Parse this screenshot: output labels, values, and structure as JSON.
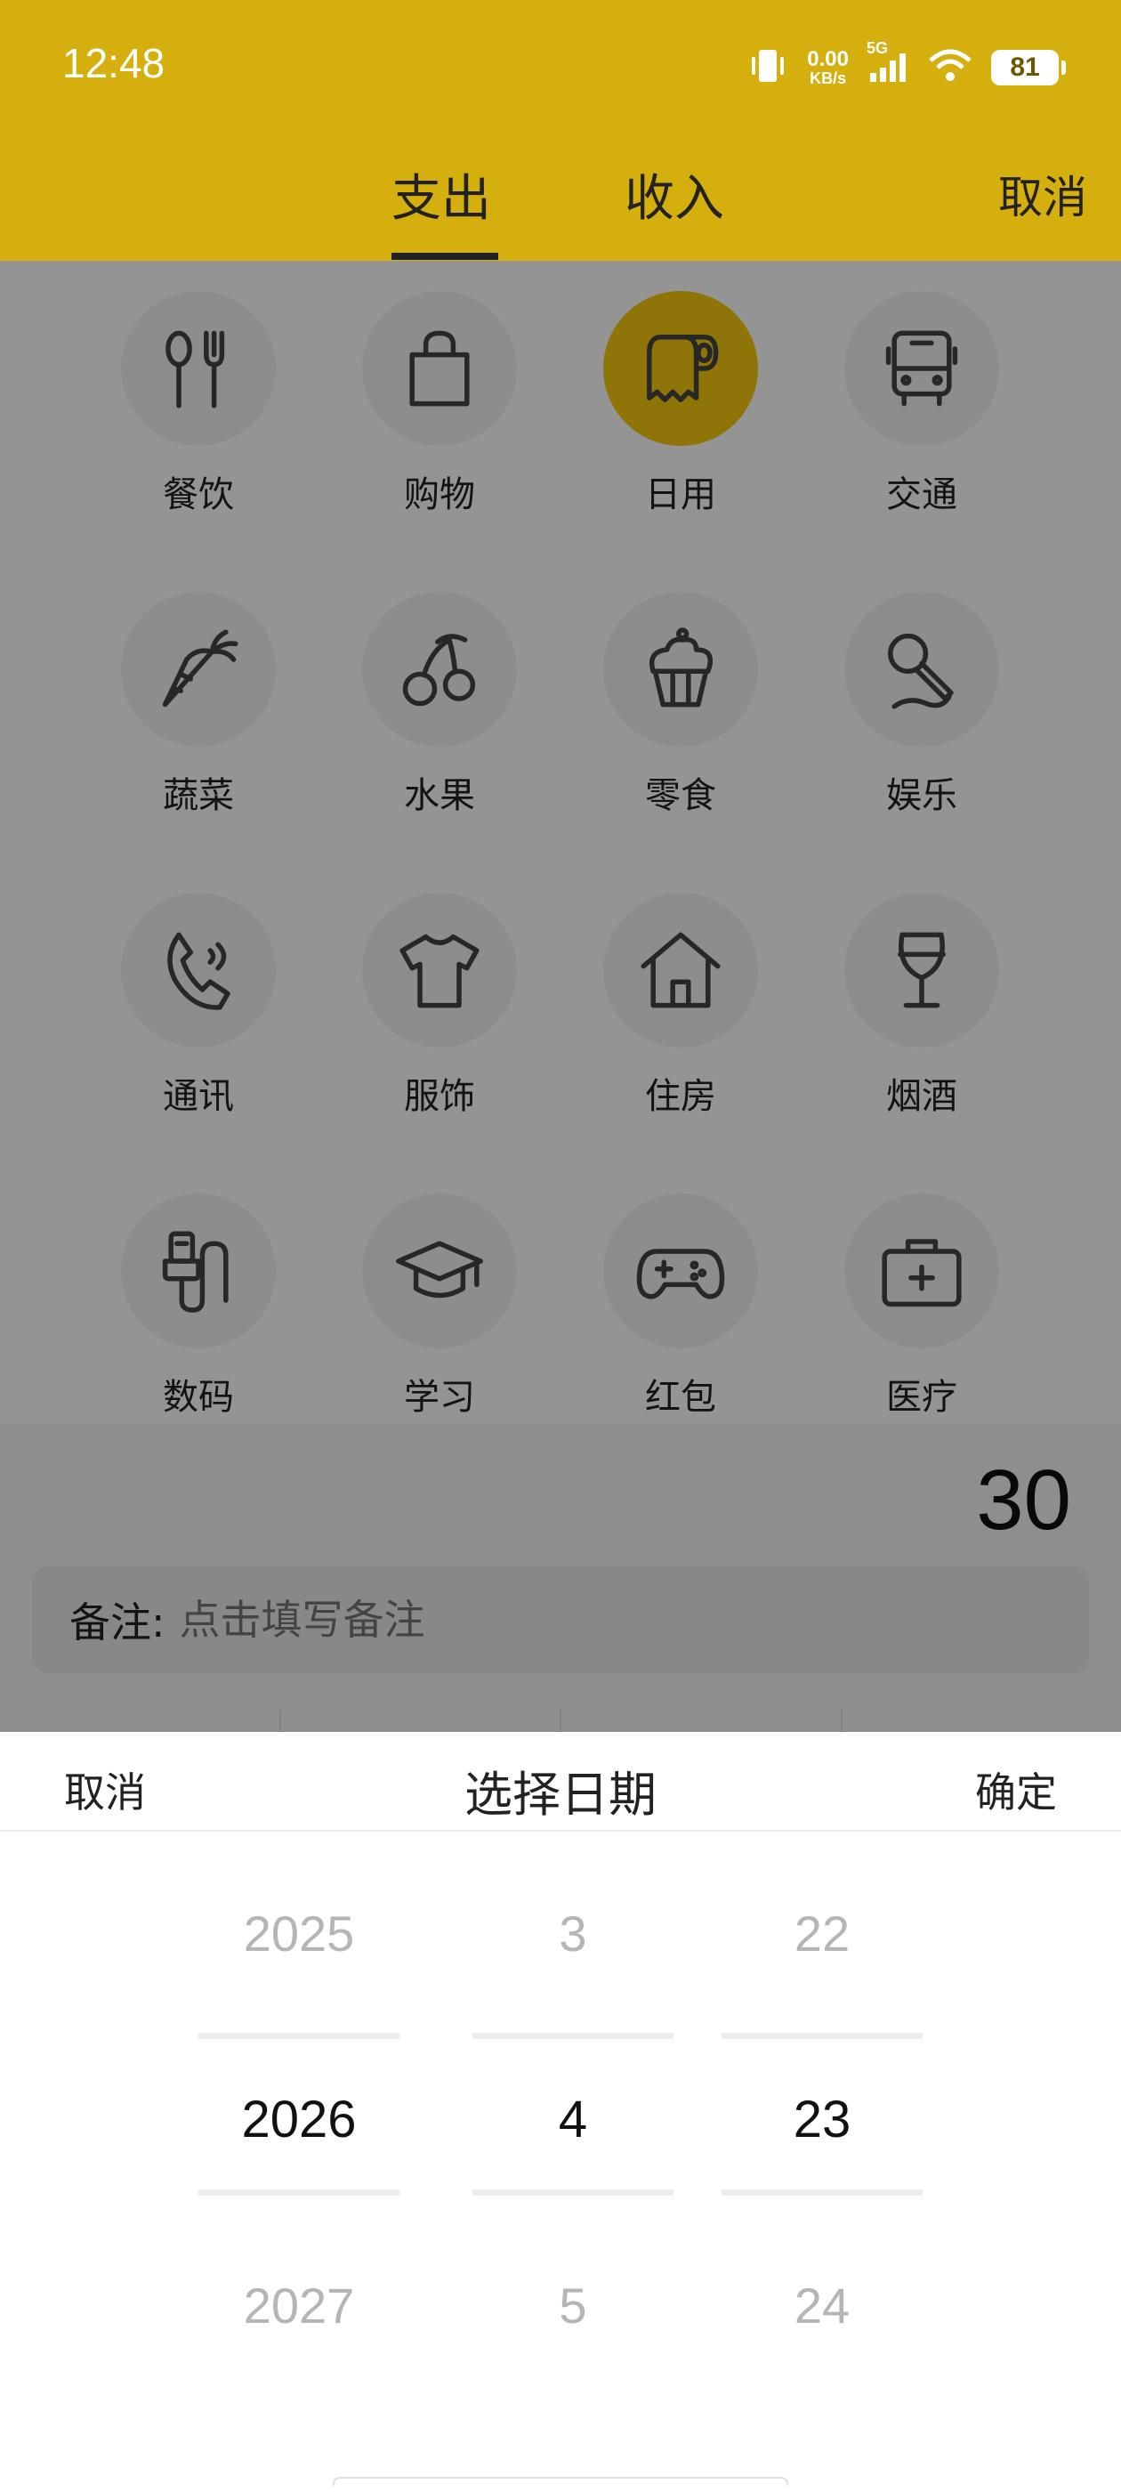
{
  "status_bar": {
    "time": "12:48",
    "net_speed_value": "0.00",
    "net_speed_unit": "KB/s",
    "network": "5G",
    "battery": "81",
    "icons": [
      "vibrate-icon",
      "signal-icon",
      "wifi-icon",
      "battery-icon"
    ]
  },
  "header": {
    "tabs": [
      {
        "label": "支出",
        "active": true
      },
      {
        "label": "收入",
        "active": false
      }
    ],
    "cancel_label": "取消"
  },
  "categories": [
    {
      "label": "餐饮",
      "icon": "cutlery-icon",
      "selected": false
    },
    {
      "label": "购物",
      "icon": "shopping-bag-icon",
      "selected": false
    },
    {
      "label": "日用",
      "icon": "toilet-paper-icon",
      "selected": true
    },
    {
      "label": "交通",
      "icon": "bus-icon",
      "selected": false
    },
    {
      "label": "蔬菜",
      "icon": "carrot-icon",
      "selected": false
    },
    {
      "label": "水果",
      "icon": "cherry-icon",
      "selected": false
    },
    {
      "label": "零食",
      "icon": "cupcake-icon",
      "selected": false
    },
    {
      "label": "娱乐",
      "icon": "microphone-icon",
      "selected": false
    },
    {
      "label": "通讯",
      "icon": "phone-icon",
      "selected": false
    },
    {
      "label": "服饰",
      "icon": "shirt-icon",
      "selected": false
    },
    {
      "label": "住房",
      "icon": "house-icon",
      "selected": false
    },
    {
      "label": "烟酒",
      "icon": "wine-glass-icon",
      "selected": false
    },
    {
      "label": "数码",
      "icon": "usb-cable-icon",
      "selected": false
    },
    {
      "label": "学习",
      "icon": "graduation-cap-icon",
      "selected": false
    },
    {
      "label": "红包",
      "icon": "gamepad-icon",
      "selected": false
    },
    {
      "label": "医疗",
      "icon": "first-aid-kit-icon",
      "selected": false
    }
  ],
  "amount": "30",
  "remark": {
    "label": "备注:",
    "placeholder": "点击填写备注"
  },
  "date_picker": {
    "cancel_label": "取消",
    "title": "选择日期",
    "confirm_label": "确定",
    "year": {
      "prev": "2025",
      "current": "2026",
      "next": "2027"
    },
    "month": {
      "prev": "3",
      "current": "4",
      "next": "5"
    },
    "day": {
      "prev": "22",
      "current": "23",
      "next": "24"
    }
  },
  "colors": {
    "accent": "#d5af0d",
    "selected_circle": "#f6c90f",
    "dim_header": "#6b5800"
  }
}
